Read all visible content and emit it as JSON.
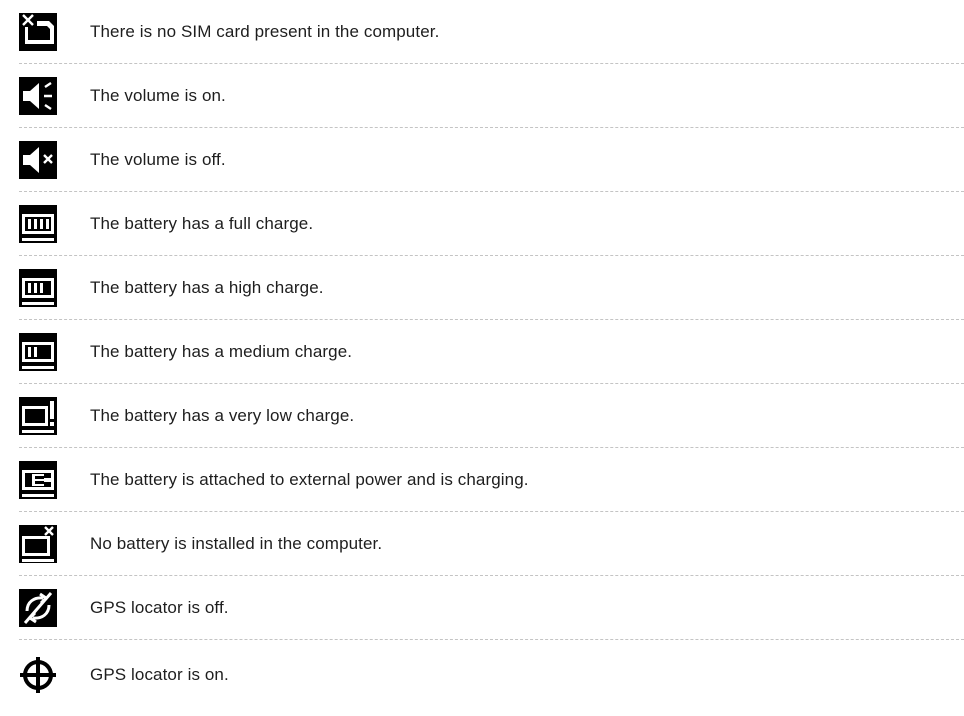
{
  "items": [
    {
      "icon": "sim-card-missing-icon",
      "text": "There is no SIM card present in the computer."
    },
    {
      "icon": "volume-on-icon",
      "text": "The volume is on."
    },
    {
      "icon": "volume-off-icon",
      "text": "The volume is off."
    },
    {
      "icon": "battery-full-icon",
      "text": "The battery has a full charge."
    },
    {
      "icon": "battery-high-icon",
      "text": "The battery has a high charge."
    },
    {
      "icon": "battery-medium-icon",
      "text": "The battery has a medium charge."
    },
    {
      "icon": "battery-very-low-icon",
      "text": "The battery has a very low charge."
    },
    {
      "icon": "battery-charging-icon",
      "text": "The battery is attached to external power and is charging."
    },
    {
      "icon": "no-battery-icon",
      "text": "No battery is installed in the computer."
    },
    {
      "icon": "gps-off-icon",
      "text": "GPS locator is off."
    },
    {
      "icon": "gps-on-icon",
      "text": "GPS locator is on."
    }
  ],
  "colors": {
    "icon": "#000000",
    "text": "#1e1e1e",
    "divider": "#c4c4c4"
  }
}
